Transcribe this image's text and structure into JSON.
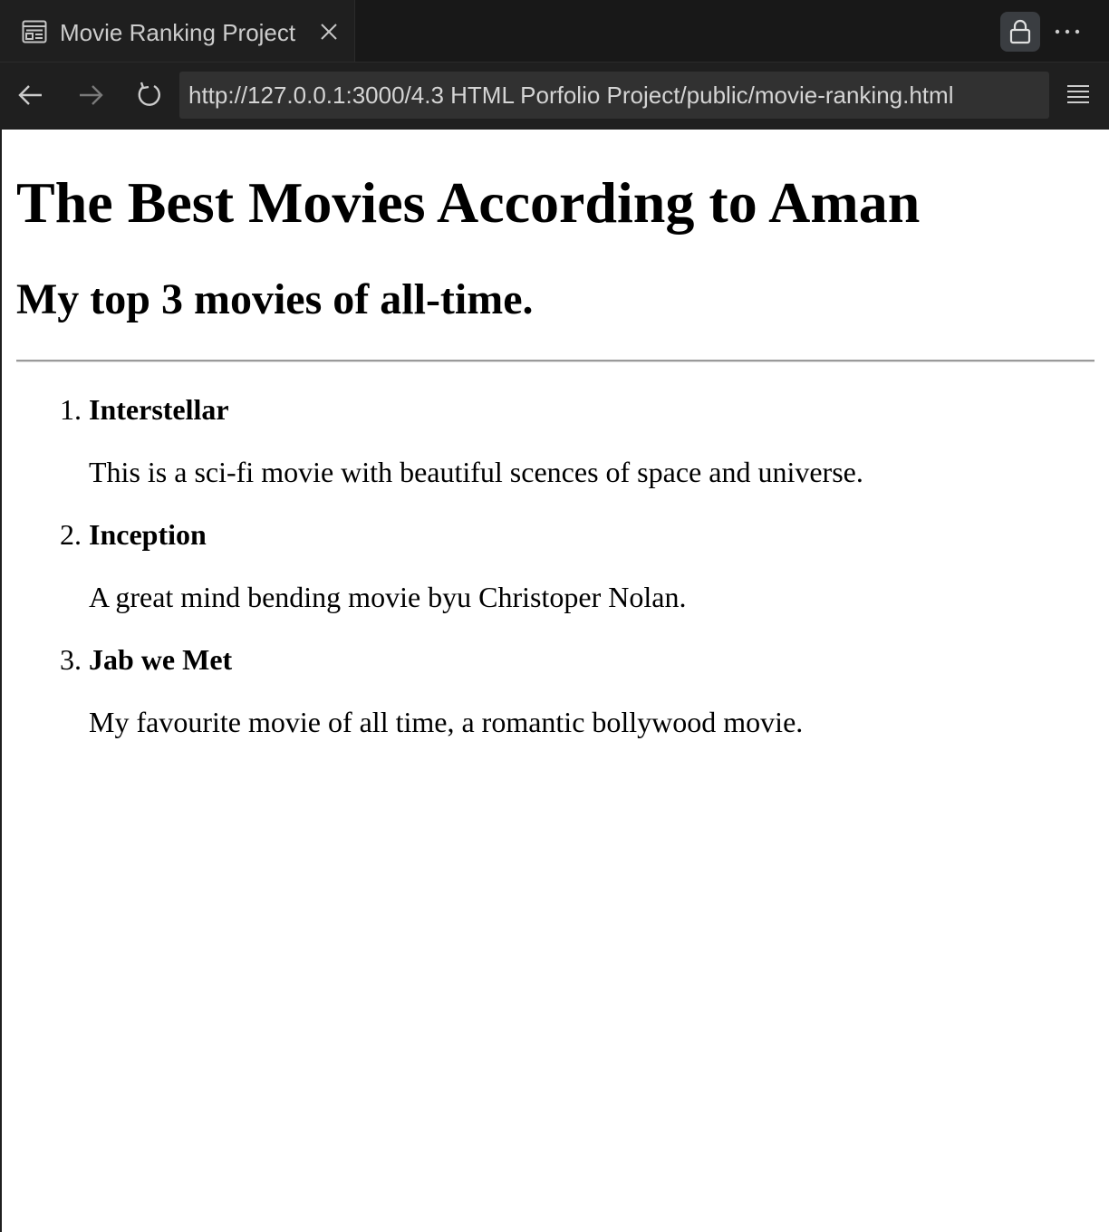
{
  "browser": {
    "tab": {
      "title": "Movie Ranking Project",
      "icon": "preview-icon",
      "close_icon": "close-icon"
    },
    "toolbar": {
      "lock_icon": "lock-icon",
      "more_icon": "more-icon",
      "back_icon": "arrow-left-icon",
      "forward_icon": "arrow-right-icon",
      "reload_icon": "reload-icon",
      "menu_icon": "menu-icon"
    },
    "address": "http://127.0.0.1:3000/4.3 HTML Porfolio Project/public/movie-ranking.html"
  },
  "page": {
    "heading": "The Best Movies According to Aman",
    "subheading": "My top 3 movies of all-time.",
    "movies": [
      {
        "number": "1.",
        "title": "Interstellar",
        "description": "This is a sci-fi movie with beautiful scences of space and universe."
      },
      {
        "number": "2.",
        "title": "Inception",
        "description": "A great mind bending movie byu Christoper Nolan."
      },
      {
        "number": "3.",
        "title": "Jab we Met",
        "description": "My favourite movie of all time, a romantic bollywood movie."
      }
    ]
  },
  "colors": {
    "chrome_dark": "#181818",
    "chrome_bar": "#1f1f1f",
    "address_bg": "#313131",
    "chrome_text": "#cccccc",
    "page_bg": "#ffffff",
    "text": "#000000"
  }
}
